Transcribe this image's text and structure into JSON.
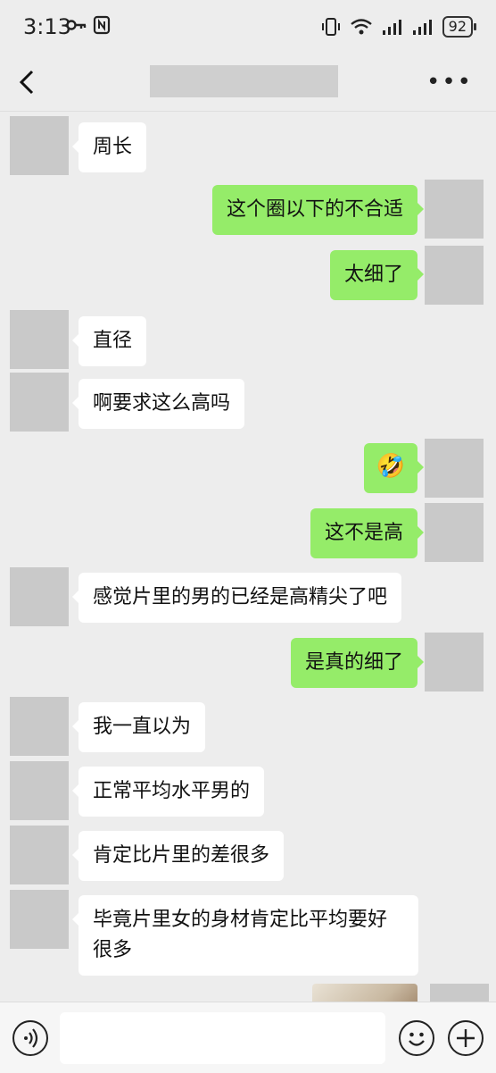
{
  "status_bar": {
    "time": "3:13",
    "battery": "92",
    "icons": [
      "key-icon",
      "nfc-icon",
      "vibrate-icon",
      "wifi-icon",
      "signal-icon",
      "signal-icon",
      "battery-icon"
    ]
  },
  "header": {
    "back_icon": "chevron-left-icon",
    "more_label": "•••"
  },
  "messages": [
    {
      "side": "in",
      "text": "周长"
    },
    {
      "side": "out",
      "text": "这个圈以下的不合适"
    },
    {
      "side": "out",
      "text": "太细了"
    },
    {
      "side": "in",
      "text": "直径"
    },
    {
      "side": "in",
      "text": "啊要求这么高吗"
    },
    {
      "side": "out",
      "text": "🤣"
    },
    {
      "side": "out",
      "text": "这不是高"
    },
    {
      "side": "in",
      "text": "感觉片里的男的已经是高精尖了吧"
    },
    {
      "side": "out",
      "text": "是真的细了"
    },
    {
      "side": "in",
      "text": "我一直以为"
    },
    {
      "side": "in",
      "text": "正常平均水平男的"
    },
    {
      "side": "in",
      "text": "肯定比片里的差很多"
    },
    {
      "side": "in",
      "text": "毕竟片里女的身材肯定比平均要好很多"
    },
    {
      "side": "out",
      "type": "image"
    }
  ],
  "input_bar": {
    "voice_icon": "voice-icon",
    "emoji_icon": "emoji-icon",
    "plus_icon": "plus-icon"
  }
}
